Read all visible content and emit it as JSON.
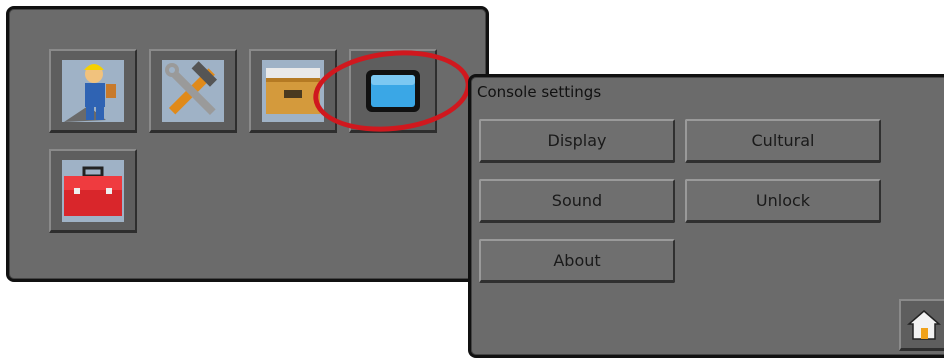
{
  "setup_menu": {
    "icons": [
      "operator-icon",
      "tools-icon",
      "file-drawer-icon",
      "console-display-icon",
      "toolbox-icon"
    ]
  },
  "console_settings": {
    "title": "Console settings",
    "buttons": {
      "display": "Display",
      "cultural": "Cultural",
      "sound": "Sound",
      "unlock": "Unlock",
      "about": "About"
    },
    "home_icon": "home-icon"
  },
  "colors": {
    "panel_background": "#6b6b6b",
    "annotation_ring": "#d0181e"
  }
}
